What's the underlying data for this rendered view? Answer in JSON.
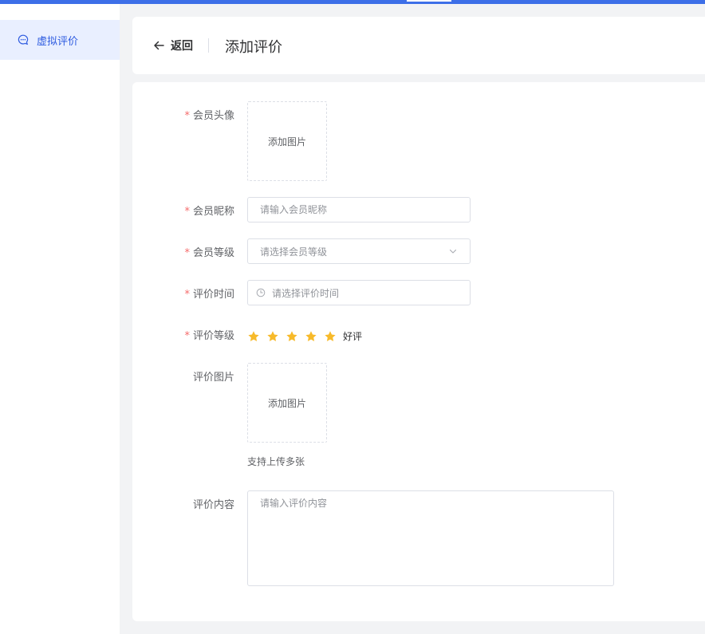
{
  "sidebar": {
    "items": [
      {
        "label": "虚拟评价",
        "icon": "chat-bubble-icon",
        "active": true
      }
    ]
  },
  "header": {
    "back_label": "返回",
    "title": "添加评价"
  },
  "form": {
    "avatar": {
      "label": "会员头像",
      "required": true,
      "upload_text": "添加图片"
    },
    "nickname": {
      "label": "会员昵称",
      "required": true,
      "placeholder": "请输入会员昵称",
      "value": ""
    },
    "level": {
      "label": "会员等级",
      "required": true,
      "placeholder": "请选择会员等级"
    },
    "time": {
      "label": "评价时间",
      "required": true,
      "placeholder": "请选择评价时间"
    },
    "rating": {
      "label": "评价等级",
      "required": true,
      "stars": 5,
      "max": 5,
      "text": "好评",
      "color": "#f7ba2a"
    },
    "images": {
      "label": "评价图片",
      "required": false,
      "upload_text": "添加图片",
      "hint": "支持上传多张"
    },
    "content": {
      "label": "评价内容",
      "required": false,
      "placeholder": "请输入评价内容",
      "value": ""
    }
  },
  "colors": {
    "accent": "#3d6fe8",
    "required": "#f56c6c",
    "star": "#f7ba2a"
  }
}
